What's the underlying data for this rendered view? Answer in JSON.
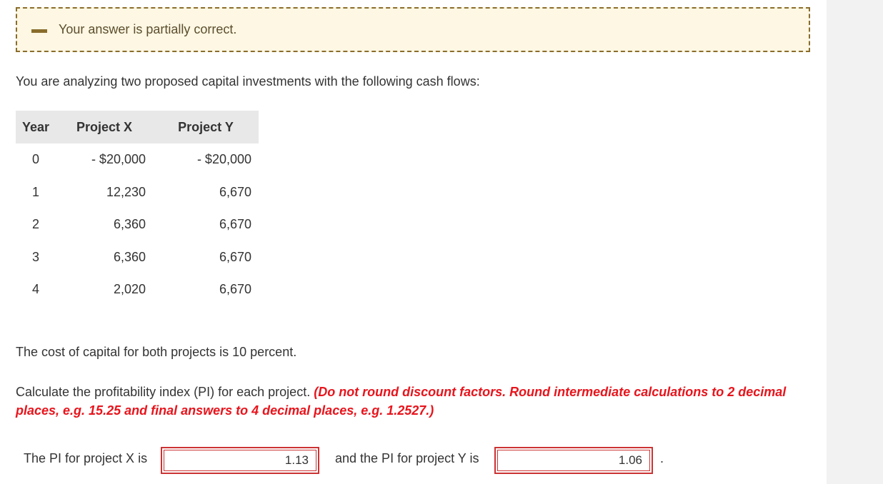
{
  "feedback": {
    "icon": "partial-dash-icon",
    "message": "Your answer is partially correct."
  },
  "intro": "You are analyzing two proposed capital investments with the following cash flows:",
  "table": {
    "headers": [
      "Year",
      "Project X",
      "Project Y"
    ],
    "rows": [
      [
        "0",
        "- $20,000",
        "- $20,000"
      ],
      [
        "1",
        "12,230",
        "6,670"
      ],
      [
        "2",
        "6,360",
        "6,670"
      ],
      [
        "3",
        "6,360",
        "6,670"
      ],
      [
        "4",
        "2,020",
        "6,670"
      ]
    ]
  },
  "cost_of_capital": "The cost of capital for both projects is 10 percent.",
  "instruction": {
    "text": "Calculate the profitability index (PI) for each project. ",
    "note": "(Do not round discount factors. Round intermediate calculations to 2 decimal places, e.g. 15.25 and final answers to 4 decimal places, e.g. 1.2527.)"
  },
  "answers": {
    "x_label": "The PI for project X is",
    "x_value": "1.13",
    "y_label": "and the PI for project Y is",
    "y_value": "1.06",
    "end_punct": "."
  },
  "colors": {
    "feedback_bg": "#fdf7e3",
    "feedback_border": "#8a6d2c",
    "note_red": "#e8141c",
    "answer_border": "#cc3333"
  }
}
